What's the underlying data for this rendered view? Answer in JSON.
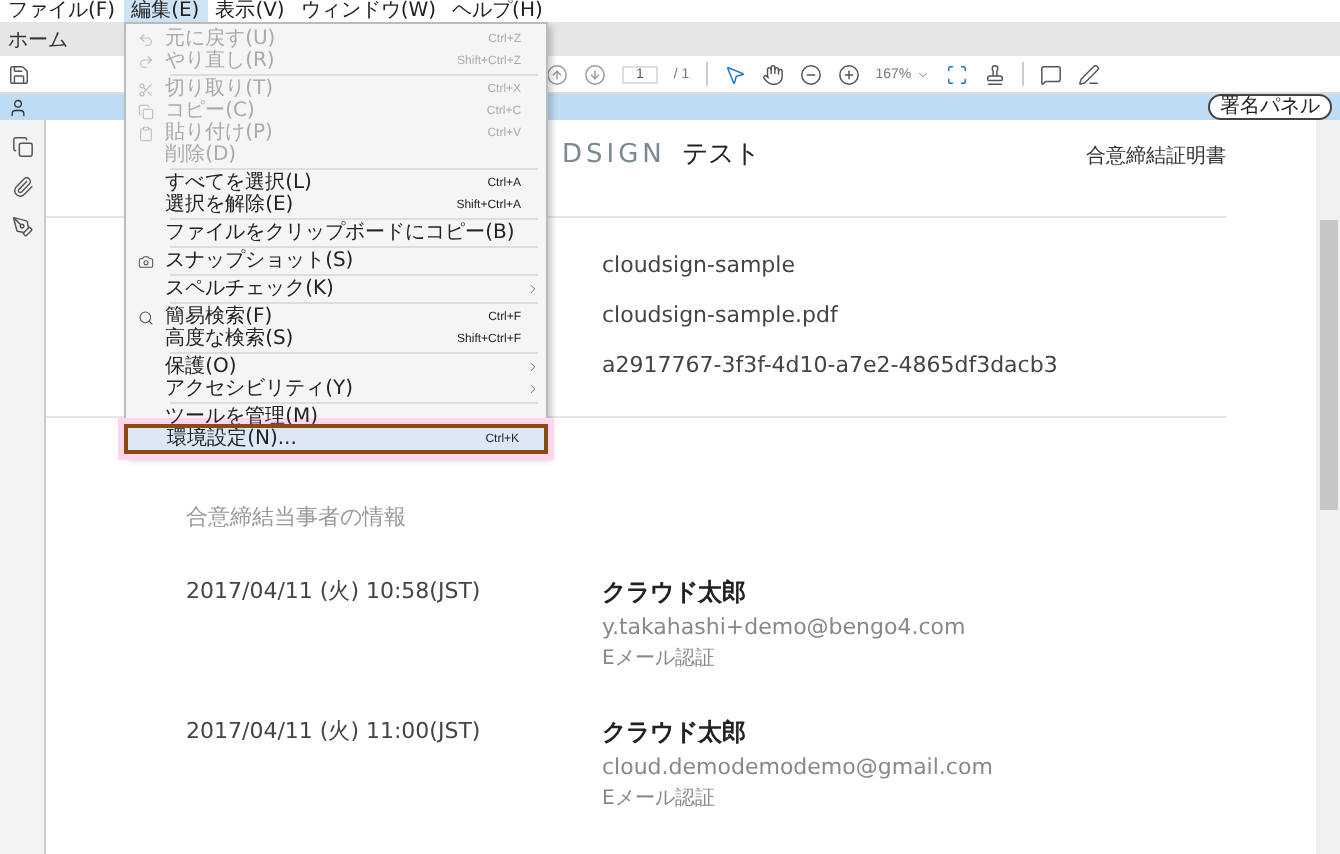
{
  "menubar": [
    {
      "label": "ファイル(F)",
      "selected": false
    },
    {
      "label": "編集(E)",
      "selected": true
    },
    {
      "label": "表示(V)",
      "selected": false
    },
    {
      "label": "ウィンドウ(W)",
      "selected": false
    },
    {
      "label": "ヘルプ(H)",
      "selected": false
    }
  ],
  "tabs": [
    {
      "label": "ホーム"
    }
  ],
  "toolbar": {
    "page_field": "1",
    "page_total": "/ 1",
    "zoom": "167%"
  },
  "sign_bar": {
    "button": "署名パネル"
  },
  "edit_menu": [
    [
      {
        "kind": "command",
        "label": "元に戻す(U)",
        "shortcut": "Ctrl+Z",
        "disabled": true,
        "selected": false
      },
      {
        "kind": "command",
        "label": "やり直し(R)",
        "shortcut": "Shift+Ctrl+Z",
        "disabled": true,
        "selected": false
      }
    ],
    [
      {
        "kind": "command",
        "label": "切り取り(T)",
        "shortcut": "Ctrl+X",
        "disabled": true,
        "selected": false
      },
      {
        "kind": "command",
        "label": "コピー(C)",
        "shortcut": "Ctrl+C",
        "disabled": true,
        "selected": false
      },
      {
        "kind": "command",
        "label": "貼り付け(P)",
        "shortcut": "Ctrl+V",
        "disabled": true,
        "selected": false
      },
      {
        "kind": "command",
        "label": "削除(D)",
        "disabled": true,
        "selected": false
      }
    ],
    [
      {
        "kind": "command",
        "label": "すべてを選択(L)",
        "shortcut": "Ctrl+A",
        "disabled": false,
        "selected": false
      },
      {
        "kind": "command",
        "label": "選択を解除(E)",
        "shortcut": "Shift+Ctrl+A",
        "disabled": false,
        "selected": false
      }
    ],
    [
      {
        "kind": "command",
        "label": "ファイルをクリップボードにコピー(B)",
        "disabled": false,
        "selected": false
      }
    ],
    [
      {
        "kind": "command",
        "label": "スナップショット(S)",
        "disabled": false,
        "selected": false
      }
    ],
    [
      {
        "kind": "submenu",
        "label": "スペルチェック(K)",
        "disabled": false,
        "selected": false
      }
    ],
    [
      {
        "kind": "command",
        "label": "簡易検索(F)",
        "shortcut": "Ctrl+F",
        "disabled": false,
        "selected": false
      },
      {
        "kind": "command",
        "label": "高度な検索(S)",
        "shortcut": "Shift+Ctrl+F",
        "disabled": false,
        "selected": false
      }
    ],
    [
      {
        "kind": "submenu",
        "label": "保護(O)",
        "disabled": false,
        "selected": false
      },
      {
        "kind": "submenu",
        "label": "アクセシビリティ(Y)",
        "disabled": false,
        "selected": false
      }
    ],
    [
      {
        "kind": "command",
        "label": "ツールを管理(M)",
        "disabled": false,
        "selected": false
      },
      {
        "kind": "command",
        "label": "環境設定(N)...",
        "shortcut": "Ctrl+K",
        "disabled": false,
        "selected": true
      }
    ]
  ],
  "document": {
    "logo": "DSIGN",
    "title": "テスト",
    "doc_title": "合意締結証明書",
    "details": [
      "cloudsign-sample",
      "cloudsign-sample.pdf",
      "a2917767-3f3f-4d10-a7e2-4865df3dacb3"
    ],
    "parties_heading": "合意締結当事者の情報",
    "parties": [
      {
        "datetime": "2017/04/11 (火) 10:58(JST)",
        "name": "クラウド太郎",
        "email": "y.takahashi+demo@bengo4.com",
        "method": "Eメール認証"
      },
      {
        "datetime": "2017/04/11 (火) 11:00(JST)",
        "name": "クラウド太郎",
        "email": "cloud.demodemodemo@gmail.com",
        "method": "Eメール認証"
      }
    ]
  }
}
